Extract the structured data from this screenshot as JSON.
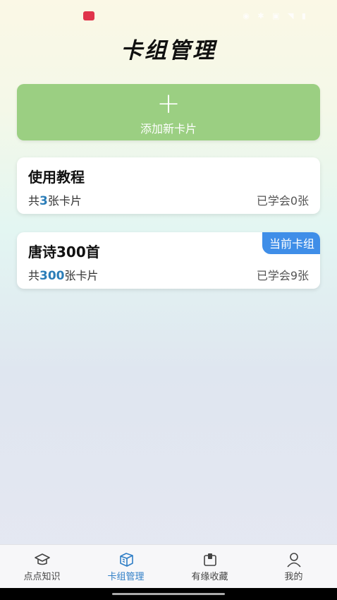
{
  "page_title": "卡组管理",
  "add_card": {
    "icon": "plus-icon",
    "label": "添加新卡片"
  },
  "decks": [
    {
      "name": "使用教程",
      "count_prefix": "共",
      "count": "3",
      "count_suffix": "张卡片",
      "learned": "已学会0张",
      "current": false
    },
    {
      "name": "唐诗300首",
      "count_prefix": "共",
      "count": "300",
      "count_suffix": "张卡片",
      "learned": "已学会9张",
      "current": true,
      "current_label": "当前卡组"
    }
  ],
  "tabs": [
    {
      "label": "点点知识",
      "icon": "graduation-cap-icon",
      "active": false
    },
    {
      "label": "卡组管理",
      "icon": "card-stack-icon",
      "active": true
    },
    {
      "label": "有缘收藏",
      "icon": "collection-icon",
      "active": false
    },
    {
      "label": "我的",
      "icon": "user-icon",
      "active": false
    }
  ],
  "colors": {
    "accent_green": "#9bcf82",
    "accent_blue": "#3f8ee8",
    "count_blue": "#2b7db8",
    "active_tab": "#2f7ec6"
  }
}
